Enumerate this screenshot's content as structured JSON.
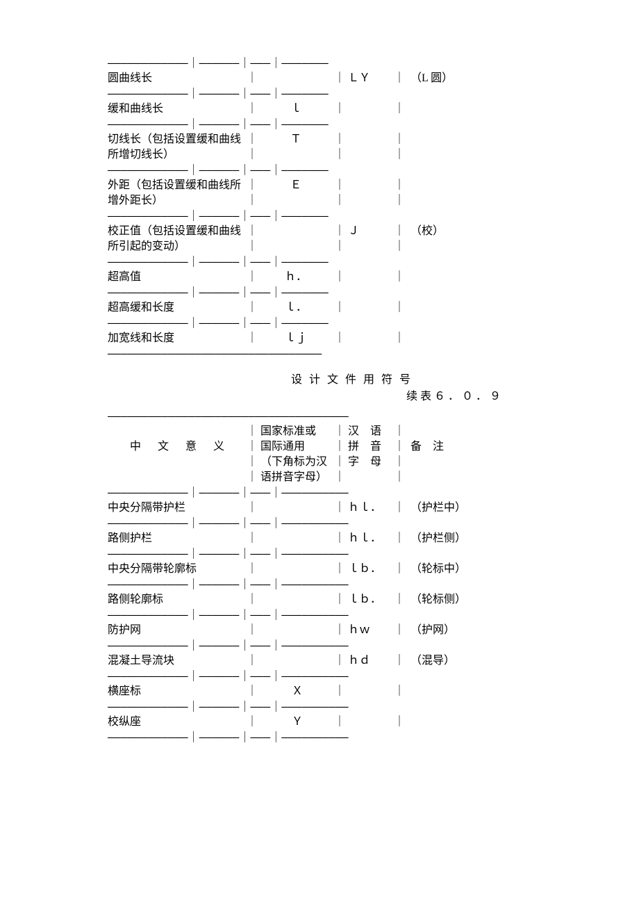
{
  "table1": {
    "rows": [
      {
        "name": "圆曲线长",
        "name2": "",
        "std": "",
        "py": "ＬＹ",
        "note": "（L 圆）"
      },
      {
        "name": "缓和曲线长",
        "name2": "",
        "std": "ｌ",
        "py": "",
        "note": ""
      },
      {
        "name": "切线长（包括设置缓和曲线",
        "name2": "所增切线长）",
        "std": "Ｔ",
        "py": "",
        "note": ""
      },
      {
        "name": "外距（包括设置缓和曲线所",
        "name2": "增外距长）",
        "std": "Ｅ",
        "py": "",
        "note": ""
      },
      {
        "name": "校正值（包括设置缓和曲线",
        "name2": "所引起的变动）",
        "std": "",
        "py": "Ｊ",
        "note": "（校）"
      },
      {
        "name": "超高值",
        "name2": "",
        "std": "ｈ．",
        "py": "",
        "note": ""
      },
      {
        "name": "超高缓和长度",
        "name2": "",
        "std": "ｌ．",
        "py": "",
        "note": ""
      },
      {
        "name": "加宽线和长度",
        "name2": "",
        "std": "ｌｊ",
        "py": "",
        "note": ""
      }
    ]
  },
  "section_title": "设计文件用符号",
  "section_sub": "续表６．０．９",
  "table2": {
    "header": {
      "c1": "中文意义",
      "c2a": "国家标准或",
      "c2b": "国际通用",
      "c2c": "（下角标为汉",
      "c2d": "语拼音字母）",
      "c3a": "汉　语",
      "c3b": "拼　音",
      "c3c": "字　母",
      "c4": "备　注"
    },
    "rows": [
      {
        "name": "中央分隔带护栏",
        "std": "",
        "py": "ｈｌ．",
        "note": "（护栏中）"
      },
      {
        "name": "路侧护栏",
        "std": "",
        "py": "ｈｌ．",
        "note": "（护栏侧）"
      },
      {
        "name": "中央分隔带轮廓标",
        "std": "",
        "py": "ｌｂ．",
        "note": "（轮标中）"
      },
      {
        "name": "路侧轮廓标",
        "std": "",
        "py": "ｌｂ．",
        "note": "（轮标侧）"
      },
      {
        "name": "防护网",
        "std": "",
        "py": "ｈｗ",
        "note": "（护网）"
      },
      {
        "name": "混凝土导流块",
        "std": "",
        "py": "ｈｄ",
        "note": "（混导）"
      },
      {
        "name": "横座标",
        "std": "Ｘ",
        "py": "",
        "note": ""
      },
      {
        "name": "校纵座",
        "std": "Ｙ",
        "py": "",
        "note": ""
      }
    ]
  },
  "dash": {
    "pipe": "｜",
    "hr1": "————————————｜——————｜———｜———————",
    "hr1end": "————————————————————————————————",
    "hr2top": "————————————————————————————————————",
    "hr2": "————————————｜——————｜———｜——————————"
  }
}
